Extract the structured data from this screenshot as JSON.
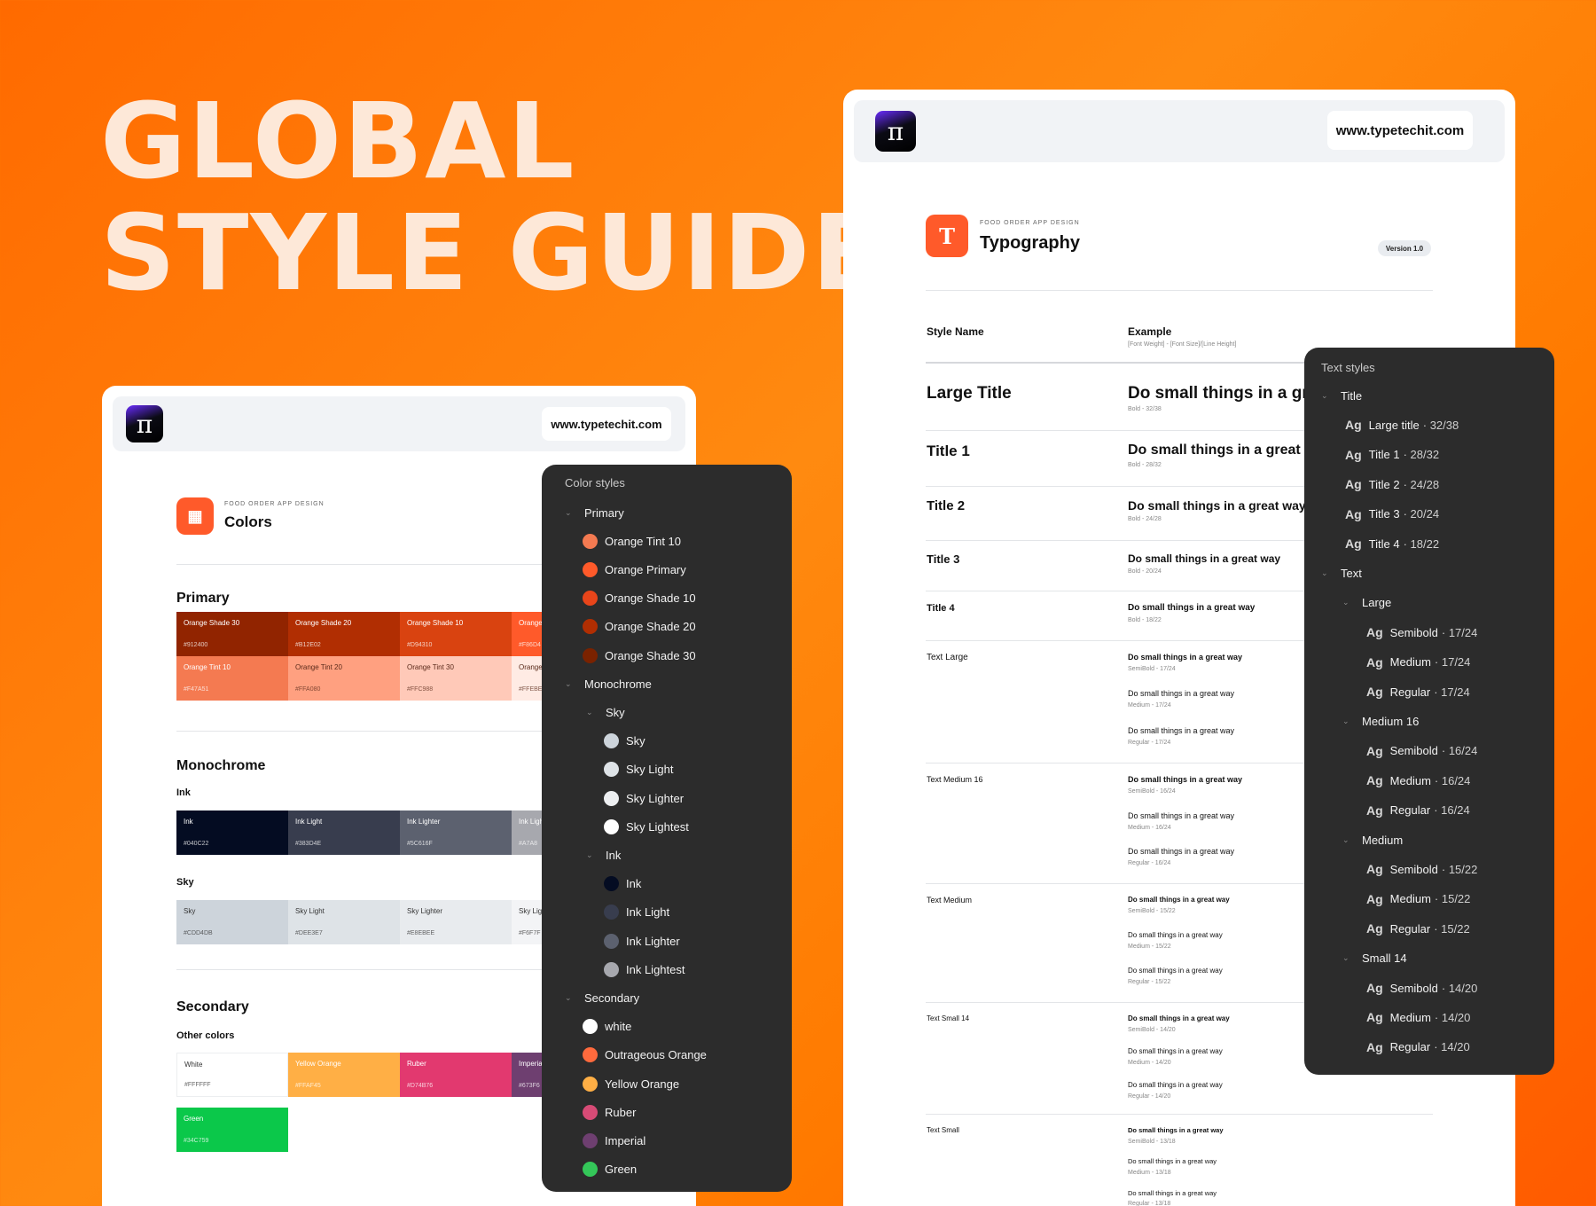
{
  "hero": {
    "line1": "GLOBAL",
    "line2": "STYLE GUIDE"
  },
  "colors_card": {
    "logo_glyph": "π",
    "url": "www.typetechit.com",
    "eyebrow": "FOOD ORDER APP DESIGN",
    "title": "Colors",
    "primary": {
      "title": "Primary",
      "row1": [
        {
          "name": "Orange Shade 30",
          "hex": "#912400",
          "color": "#912400",
          "fg": "#ffffff"
        },
        {
          "name": "Orange Shade 20",
          "hex": "#B12E02",
          "color": "#B12E02",
          "fg": "#ffffff"
        },
        {
          "name": "Orange Shade 10",
          "hex": "#D94310",
          "color": "#D94310",
          "fg": "#ffffff"
        },
        {
          "name": "Orange",
          "hex": "#F86D4",
          "color": "#FF5A2A",
          "fg": "#ffffff"
        }
      ],
      "row2": [
        {
          "name": "Orange Tint 10",
          "hex": "#F47A51",
          "color": "#F47A51",
          "fg": "#ffffff"
        },
        {
          "name": "Orange Tint 20",
          "hex": "#FFA080",
          "color": "#FFA080",
          "fg": "#5a2a1a"
        },
        {
          "name": "Orange Tint 30",
          "hex": "#FFC988",
          "color": "#FFC9B8",
          "fg": "#5a2a1a"
        },
        {
          "name": "Orange",
          "hex": "#FFEBE",
          "color": "#FFEBE4",
          "fg": "#5a2a1a"
        }
      ]
    },
    "monochrome": {
      "title": "Monochrome",
      "ink_title": "Ink",
      "ink": [
        {
          "name": "Ink",
          "hex": "#040C22",
          "color": "#040C22",
          "fg": "#ffffff"
        },
        {
          "name": "Ink Light",
          "hex": "#383D4E",
          "color": "#383D4E",
          "fg": "#ffffff"
        },
        {
          "name": "Ink Lighter",
          "hex": "#5C616F",
          "color": "#5C616F",
          "fg": "#ffffff"
        },
        {
          "name": "Ink Ligh",
          "hex": "#A7A8",
          "color": "#A7A8AE",
          "fg": "#ffffff"
        }
      ],
      "sky_title": "Sky",
      "sky": [
        {
          "name": "Sky",
          "hex": "#CDD4DB",
          "color": "#CDD4DB",
          "fg": "#333"
        },
        {
          "name": "Sky Light",
          "hex": "#DEE3E7",
          "color": "#DEE3E7",
          "fg": "#333"
        },
        {
          "name": "Sky Lighter",
          "hex": "#E8EBEE",
          "color": "#E8EBEE",
          "fg": "#333"
        },
        {
          "name": "Sky Lig",
          "hex": "#F6F7F",
          "color": "#F3F4F6",
          "fg": "#333"
        }
      ]
    },
    "secondary": {
      "title": "Secondary",
      "other_title": "Other colors",
      "row1": [
        {
          "name": "White",
          "hex": "#FFFFFF",
          "color": "#FFFFFF",
          "fg": "#333"
        },
        {
          "name": "Yellow Orange",
          "hex": "#FFAF45",
          "color": "#FFAF45",
          "fg": "#fff"
        },
        {
          "name": "Ruber",
          "hex": "#D74B76",
          "color": "#E2396F",
          "fg": "#fff"
        },
        {
          "name": "Imperia",
          "hex": "#673F6",
          "color": "#6E3F70",
          "fg": "#fff"
        }
      ],
      "row2": [
        {
          "name": "Green",
          "hex": "#34C759",
          "color": "#0BC84A",
          "fg": "#fff"
        }
      ]
    }
  },
  "color_styles_panel": {
    "title": "Color styles",
    "rows": [
      {
        "type": "group",
        "label": "Primary",
        "indent": 0
      },
      {
        "type": "color",
        "label": "Orange Tint 10",
        "color": "#F47A51",
        "indent": 1
      },
      {
        "type": "color",
        "label": "Orange Primary",
        "color": "#FF5A2A",
        "indent": 1
      },
      {
        "type": "color",
        "label": "Orange Shade 10",
        "color": "#E8451A",
        "indent": 1
      },
      {
        "type": "color",
        "label": "Orange Shade 20",
        "color": "#B12E02",
        "indent": 1
      },
      {
        "type": "color",
        "label": "Orange Shade 30",
        "color": "#7A2200",
        "indent": 1
      },
      {
        "type": "group",
        "label": "Monochrome",
        "indent": 0
      },
      {
        "type": "group",
        "label": "Sky",
        "indent": 1
      },
      {
        "type": "color",
        "label": "Sky",
        "color": "#CDD4DB",
        "indent": 2
      },
      {
        "type": "color",
        "label": "Sky Light",
        "color": "#DEE3E7",
        "indent": 2
      },
      {
        "type": "color",
        "label": "Sky Lighter",
        "color": "#EDEFF1",
        "indent": 2
      },
      {
        "type": "color",
        "label": "Sky Lightest",
        "color": "#FFFFFF",
        "indent": 2
      },
      {
        "type": "group",
        "label": "Ink",
        "indent": 1
      },
      {
        "type": "color",
        "label": "Ink",
        "color": "#040C22",
        "indent": 2
      },
      {
        "type": "color",
        "label": "Ink Light",
        "color": "#383D4E",
        "indent": 2
      },
      {
        "type": "color",
        "label": "Ink Lighter",
        "color": "#5C616F",
        "indent": 2
      },
      {
        "type": "color",
        "label": "Ink Lightest",
        "color": "#A7A8AE",
        "indent": 2
      },
      {
        "type": "group",
        "label": "Secondary",
        "indent": 0
      },
      {
        "type": "color",
        "label": "white",
        "color": "#FFFFFF",
        "indent": 1
      },
      {
        "type": "color",
        "label": "Outrageous Orange",
        "color": "#FF6A3D",
        "indent": 1
      },
      {
        "type": "color",
        "label": "Yellow Orange",
        "color": "#FFAF45",
        "indent": 1
      },
      {
        "type": "color",
        "label": "Ruber",
        "color": "#D74B76",
        "indent": 1
      },
      {
        "type": "color",
        "label": "Imperial",
        "color": "#6E3F70",
        "indent": 1
      },
      {
        "type": "color",
        "label": "Green",
        "color": "#34C759",
        "indent": 1
      }
    ]
  },
  "typo_card": {
    "logo_glyph": "π",
    "url": "www.typetechit.com",
    "eyebrow": "FOOD ORDER APP DESIGN",
    "title": "Typography",
    "icon_glyph": "T",
    "version": "Version 1.0",
    "col_style": "Style Name",
    "col_example": "Example",
    "col_example_sub": "[Font Weight] - [Font Size]/[Line Height]",
    "rows": [
      {
        "name": "Large Title",
        "examples": [
          {
            "text": "Do small things in a gr",
            "meta": "Bold - 32/38"
          }
        ]
      },
      {
        "name": "Title 1",
        "examples": [
          {
            "text": "Do small things in a great",
            "meta": "Bold - 28/32"
          }
        ]
      },
      {
        "name": "Title 2",
        "examples": [
          {
            "text": "Do small things in a great way",
            "meta": "Bold - 24/28"
          }
        ]
      },
      {
        "name": "Title 3",
        "examples": [
          {
            "text": "Do small things in a great way",
            "meta": "Bold - 20/24"
          }
        ]
      },
      {
        "name": "Title 4",
        "examples": [
          {
            "text": "Do small things in a great way",
            "meta": "Bold - 18/22"
          }
        ]
      },
      {
        "name": "Text Large",
        "examples": [
          {
            "text": "Do small things in a great way",
            "meta": "SemiBold - 17/24"
          },
          {
            "text": "Do small things in a great way",
            "meta": "Medium - 17/24"
          },
          {
            "text": "Do small things in a great way",
            "meta": "Regular - 17/24"
          }
        ]
      },
      {
        "name": "Text Medium 16",
        "examples": [
          {
            "text": "Do small things in a great way",
            "meta": "SemiBold - 16/24"
          },
          {
            "text": "Do small things in a great way",
            "meta": "Medium - 16/24"
          },
          {
            "text": "Do small things in a great way",
            "meta": "Regular - 16/24"
          }
        ]
      },
      {
        "name": "Text Medium",
        "examples": [
          {
            "text": "Do small things in a great way",
            "meta": "SemiBold - 15/22"
          },
          {
            "text": "Do small things in a great way",
            "meta": "Medium - 15/22"
          },
          {
            "text": "Do small things in a great way",
            "meta": "Regular - 15/22"
          }
        ]
      },
      {
        "name": "Text Small 14",
        "examples": [
          {
            "text": "Do small things in a great way",
            "meta": "SemiBold - 14/20"
          },
          {
            "text": "Do small things in a great way",
            "meta": "Medium - 14/20"
          },
          {
            "text": "Do small things in a great way",
            "meta": "Regular - 14/20"
          }
        ]
      },
      {
        "name": "Text Small",
        "examples": [
          {
            "text": "Do small things in a great way",
            "meta": "SemiBold - 13/18"
          },
          {
            "text": "Do small things in a great way",
            "meta": "Medium - 13/18"
          },
          {
            "text": "Do small things in a great way",
            "meta": "Regular - 13/18"
          }
        ]
      }
    ]
  },
  "text_styles_panel": {
    "title": "Text styles",
    "ag": "Ag",
    "rows": [
      {
        "type": "group",
        "label": "Title",
        "indent": 0
      },
      {
        "type": "style",
        "label": "Large title",
        "size": "· 32/38",
        "indent": 1
      },
      {
        "type": "style",
        "label": "Title 1",
        "size": "· 28/32",
        "indent": 1
      },
      {
        "type": "style",
        "label": "Title 2",
        "size": "· 24/28",
        "indent": 1
      },
      {
        "type": "style",
        "label": "Title 3",
        "size": "· 20/24",
        "indent": 1
      },
      {
        "type": "style",
        "label": "Title 4",
        "size": "· 18/22",
        "indent": 1
      },
      {
        "type": "group",
        "label": "Text",
        "indent": 0
      },
      {
        "type": "group",
        "label": "Large",
        "indent": 1
      },
      {
        "type": "style",
        "label": "Semibold",
        "size": "· 17/24",
        "indent": 2
      },
      {
        "type": "style",
        "label": "Medium",
        "size": "· 17/24",
        "indent": 2
      },
      {
        "type": "style",
        "label": "Regular",
        "size": "· 17/24",
        "indent": 2
      },
      {
        "type": "group",
        "label": "Medium 16",
        "indent": 1
      },
      {
        "type": "style",
        "label": "Semibold",
        "size": "· 16/24",
        "indent": 2
      },
      {
        "type": "style",
        "label": "Medium",
        "size": "· 16/24",
        "indent": 2
      },
      {
        "type": "style",
        "label": "Regular",
        "size": "· 16/24",
        "indent": 2
      },
      {
        "type": "group",
        "label": "Medium",
        "indent": 1
      },
      {
        "type": "style",
        "label": "Semibold",
        "size": "· 15/22",
        "indent": 2
      },
      {
        "type": "style",
        "label": "Medium",
        "size": "· 15/22",
        "indent": 2
      },
      {
        "type": "style",
        "label": "Regular",
        "size": "· 15/22",
        "indent": 2
      },
      {
        "type": "group",
        "label": "Small 14",
        "indent": 1
      },
      {
        "type": "style",
        "label": "Semibold",
        "size": "· 14/20",
        "indent": 2
      },
      {
        "type": "style",
        "label": "Medium",
        "size": "· 14/20",
        "indent": 2
      },
      {
        "type": "style",
        "label": "Regular",
        "size": "· 14/20",
        "indent": 2
      }
    ]
  }
}
